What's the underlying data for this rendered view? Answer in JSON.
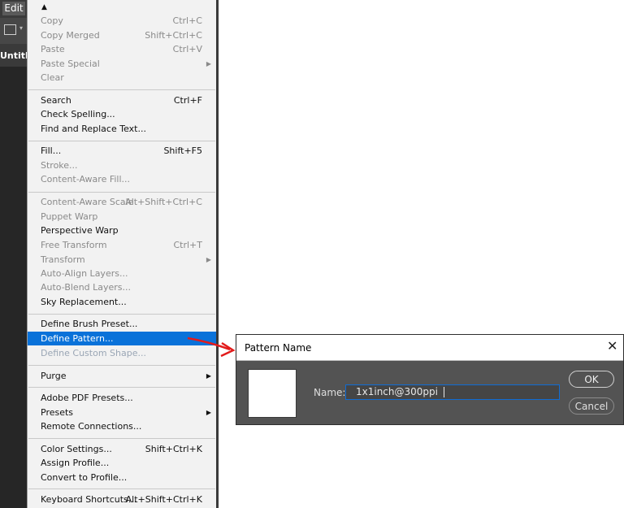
{
  "app": {
    "edit_menu_label": "Edit",
    "doc_tab": "Untitled"
  },
  "menu": {
    "scroll_indicator": "▲",
    "items": [
      {
        "label": "Copy",
        "shortcut": "Ctrl+C",
        "state": "disabled"
      },
      {
        "label": "Copy Merged",
        "shortcut": "Shift+Ctrl+C",
        "state": "disabled"
      },
      {
        "label": "Paste",
        "shortcut": "Ctrl+V",
        "state": "disabled"
      },
      {
        "label": "Paste Special",
        "shortcut": "",
        "state": "disabled",
        "submenu": true
      },
      {
        "label": "Clear",
        "shortcut": "",
        "state": "disabled"
      },
      {
        "label": "Search",
        "shortcut": "Ctrl+F",
        "state": "enabled"
      },
      {
        "label": "Check Spelling...",
        "shortcut": "",
        "state": "enabled"
      },
      {
        "label": "Find and Replace Text...",
        "shortcut": "",
        "state": "enabled"
      },
      {
        "label": "Fill...",
        "shortcut": "Shift+F5",
        "state": "enabled"
      },
      {
        "label": "Stroke...",
        "shortcut": "",
        "state": "disabled"
      },
      {
        "label": "Content-Aware Fill...",
        "shortcut": "",
        "state": "disabled"
      },
      {
        "label": "Content-Aware Scale",
        "shortcut": "Alt+Shift+Ctrl+C",
        "state": "disabled"
      },
      {
        "label": "Puppet Warp",
        "shortcut": "",
        "state": "disabled"
      },
      {
        "label": "Perspective Warp",
        "shortcut": "",
        "state": "enabled"
      },
      {
        "label": "Free Transform",
        "shortcut": "Ctrl+T",
        "state": "disabled"
      },
      {
        "label": "Transform",
        "shortcut": "",
        "state": "disabled",
        "submenu": true
      },
      {
        "label": "Auto-Align Layers...",
        "shortcut": "",
        "state": "disabled"
      },
      {
        "label": "Auto-Blend Layers...",
        "shortcut": "",
        "state": "disabled"
      },
      {
        "label": "Sky Replacement...",
        "shortcut": "",
        "state": "enabled"
      },
      {
        "label": "Define Brush Preset...",
        "shortcut": "",
        "state": "enabled"
      },
      {
        "label": "Define Pattern...",
        "shortcut": "",
        "state": "highlighted"
      },
      {
        "label": "Define Custom Shape...",
        "shortcut": "",
        "state": "disabled"
      },
      {
        "label": "Purge",
        "shortcut": "",
        "state": "enabled",
        "submenu": true
      },
      {
        "label": "Adobe PDF Presets...",
        "shortcut": "",
        "state": "enabled"
      },
      {
        "label": "Presets",
        "shortcut": "",
        "state": "enabled",
        "submenu": true
      },
      {
        "label": "Remote Connections...",
        "shortcut": "",
        "state": "enabled"
      },
      {
        "label": "Color Settings...",
        "shortcut": "Shift+Ctrl+K",
        "state": "enabled"
      },
      {
        "label": "Assign Profile...",
        "shortcut": "",
        "state": "enabled"
      },
      {
        "label": "Convert to Profile...",
        "shortcut": "",
        "state": "enabled"
      },
      {
        "label": "Keyboard Shortcuts...",
        "shortcut": "Alt+Shift+Ctrl+K",
        "state": "enabled"
      }
    ]
  },
  "dialog": {
    "title": "Pattern Name",
    "name_label": "Name:",
    "name_value": "1x1inch@300ppi",
    "ok_label": "OK",
    "cancel_label": "Cancel"
  },
  "colors": {
    "highlight": "#0a72d9",
    "annotation_arrow": "#e21b1b",
    "dialog_bg": "#535353",
    "input_focus": "#0f6cd5"
  }
}
